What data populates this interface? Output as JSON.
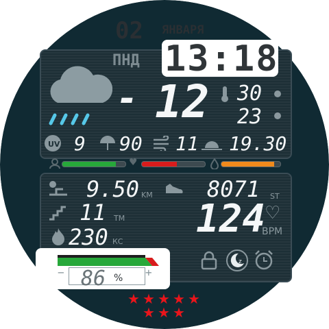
{
  "date": {
    "day": "02",
    "month": "ЯНВАРЯ",
    "weekday": "ПНД"
  },
  "time": "13:18",
  "weather": {
    "temp_sign": "-",
    "temp": "12",
    "temp_max": "30",
    "temp_min": "23",
    "uv": "9",
    "rain_chance": "90",
    "wind": "11",
    "sunset": "19.30"
  },
  "bars": {
    "steps_goal": 0.85,
    "heart_zone": 0.55,
    "battery_level": 0.9
  },
  "activity": {
    "distance": "9.50",
    "distance_unit": "KM",
    "steps": "8071",
    "steps_unit": "ST",
    "floors": "11",
    "floors_unit": "ТМ",
    "calories": "230",
    "calories_unit": "КС",
    "heart_rate": "124",
    "heart_unit": "BPM"
  },
  "battery": {
    "percent": "86",
    "percent_sign": "%",
    "minus": "−",
    "plus": "+"
  },
  "stars": {
    "count": 8
  },
  "colors": {
    "green": "#27a83a",
    "red": "#d81c1c",
    "orange": "#f08a1c",
    "rain": "#56c8e8",
    "bg": "#102a33"
  }
}
